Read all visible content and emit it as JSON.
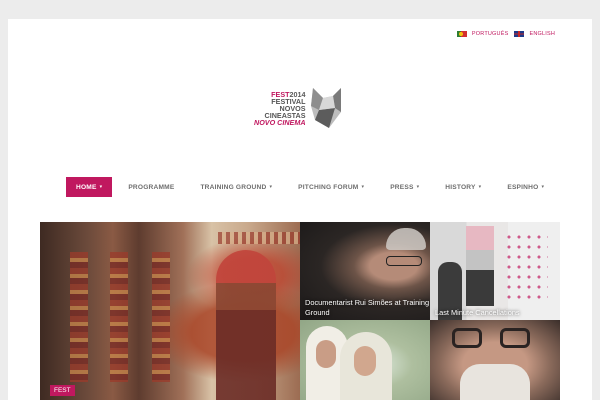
{
  "languages": [
    {
      "label": "PORTUGUÊS",
      "flag": "pt-flag-icon"
    },
    {
      "label": "ENGLISH",
      "flag": "uk-flag-icon"
    }
  ],
  "logo": {
    "fest": "FEST",
    "year": "2014",
    "line2": "FESTIVAL",
    "line3": "NOVOS",
    "line4": "CINEASTAS",
    "line5": "NOVO CINEMA"
  },
  "nav": [
    {
      "label": "HOME",
      "has_dropdown": true,
      "active": true
    },
    {
      "label": "PROGRAMME",
      "has_dropdown": false
    },
    {
      "label": "TRAINING GROUND",
      "has_dropdown": true
    },
    {
      "label": "PITCHING FORUM",
      "has_dropdown": true
    },
    {
      "label": "PRESS",
      "has_dropdown": true
    },
    {
      "label": "HISTORY",
      "has_dropdown": true
    },
    {
      "label": "ESPINHO",
      "has_dropdown": true
    }
  ],
  "tiles": {
    "big": {
      "tag": "FEST"
    },
    "t1": {
      "caption": "Documentarist Rui Simões at Training Ground"
    },
    "t2": {
      "caption": "Last Minute Cancellations"
    }
  },
  "colors": {
    "accent": "#c0185f",
    "page_bg": "#ececec"
  }
}
